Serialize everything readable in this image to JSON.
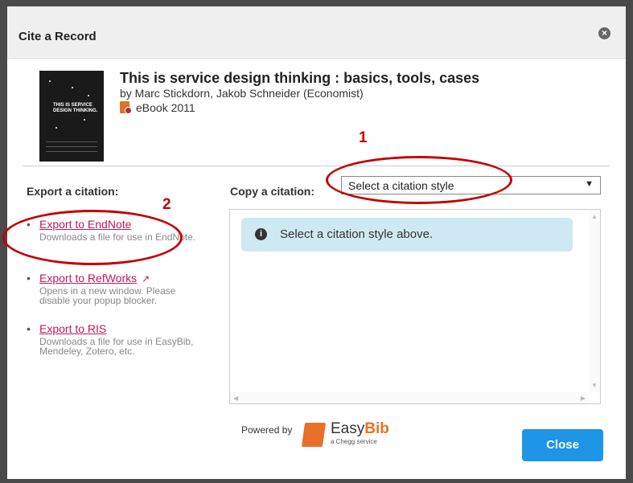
{
  "dialog": {
    "title": "Cite a Record",
    "close_icon": "×"
  },
  "record": {
    "cover_text": "THIS IS SERVICE DESIGN THINKING.",
    "title": "This is service design thinking : basics, tools, cases",
    "authors": "by Marc Stickdorn, Jakob Schneider (Economist)",
    "format_icon": "ebook-icon",
    "format": "eBook 2011"
  },
  "export": {
    "heading": "Export a citation:",
    "items": [
      {
        "label": "Export to EndNote",
        "desc": "Downloads a file for use in EndNote."
      },
      {
        "label": "Export to RefWorks",
        "desc": "Opens in a new window. Please disable your popup blocker."
      },
      {
        "label": "Export to RIS",
        "desc": "Downloads a file for use in EasyBib, Mendeley, Zotero, etc."
      }
    ]
  },
  "copy": {
    "heading": "Copy a citation:",
    "select_value": "Select a citation style",
    "info_message": "Select a citation style above."
  },
  "footer": {
    "powered_by": "Powered by",
    "brand_easy": "Easy",
    "brand_bib": "Bib",
    "brand_sub": "a Chegg service",
    "close_label": "Close"
  },
  "annotations": {
    "num1": "1",
    "num2": "2",
    "color": "#c40000"
  },
  "colors": {
    "link": "#c2185b",
    "button": "#1e95e6",
    "info_bg": "#cfe9f2",
    "brand": "#e8702a"
  }
}
